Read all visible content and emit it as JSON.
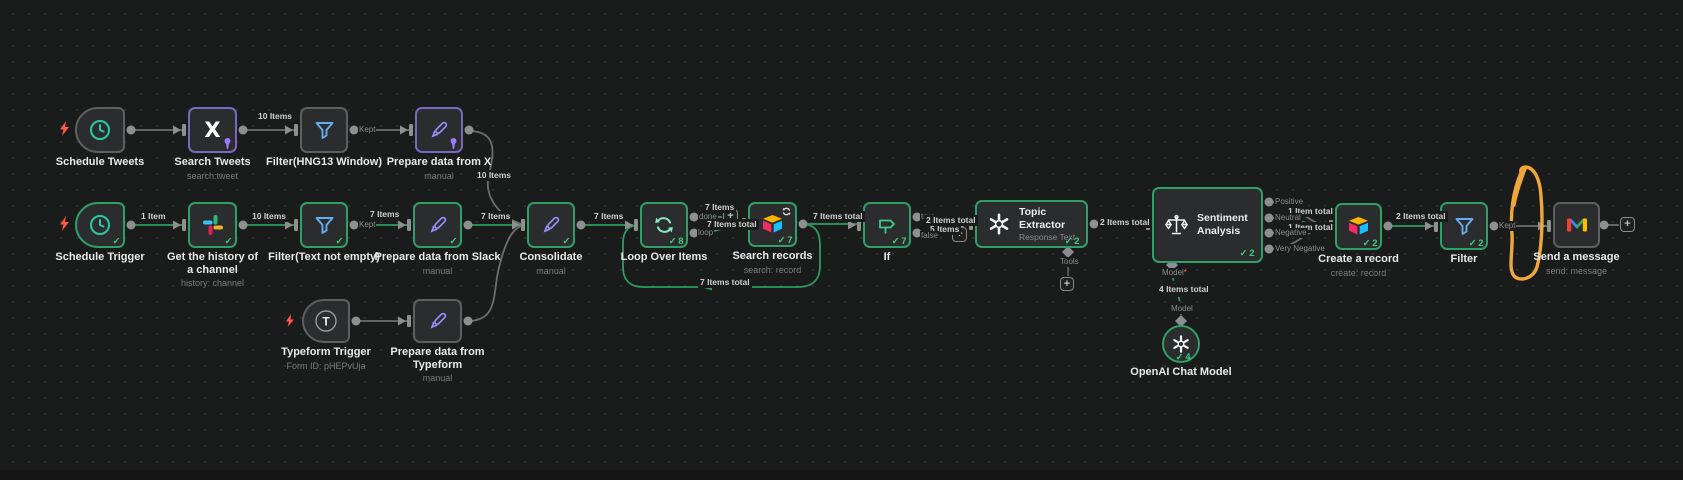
{
  "app": {
    "name": "n8n workflow canvas"
  },
  "colors": {
    "canvas_bg": "#1a1b1b",
    "dot": "#2d2e2e",
    "success_green": "#2f9e68",
    "pinned_purple": "#7a68c0",
    "line_gray": "#6e6e6e",
    "line_green": "#2c9c62",
    "annotation_orange": "#efa63c",
    "bolt_red": "#ff5a47",
    "funnel_blue": "#64aef0",
    "pencil_purple": "#9e8bf5",
    "clock_teal": "#2cc7a4",
    "loop_mint": "#87e5c0",
    "if_green": "#40cb83"
  },
  "nodes": {
    "schedule_tweets": {
      "title": "Schedule Tweets"
    },
    "search_tweets": {
      "title": "Search Tweets",
      "subtitle": "search:tweet"
    },
    "filter_hng13": {
      "title": "Filter(HNG13 Window)"
    },
    "prepare_x": {
      "title": "Prepare data from X",
      "subtitle": "manual"
    },
    "schedule_trigger": {
      "title": "Schedule Trigger",
      "badge": "✓"
    },
    "get_history": {
      "title": "Get the history of a channel",
      "subtitle": "history: channel",
      "badge": "✓"
    },
    "filter_text": {
      "title": "Filter(Text not empty)",
      "badge": "✓"
    },
    "prepare_slack": {
      "title": "Prepare data from Slack",
      "subtitle": "manual",
      "badge": "✓"
    },
    "typeform_trigger": {
      "title": "Typeform Trigger",
      "subtitle": "Form ID: pHEPvUja"
    },
    "prepare_typeform": {
      "title": "Prepare data from Typeform",
      "subtitle": "manual"
    },
    "consolidate": {
      "title": "Consolidate",
      "subtitle": "manual",
      "badge": "✓"
    },
    "loop_over_items": {
      "title": "Loop Over Items",
      "badge": "✓ 8"
    },
    "search_records": {
      "title": "Search records",
      "subtitle": "search: record",
      "badge": "✓ 7"
    },
    "if_node": {
      "title": "If",
      "badge": "✓ 7"
    },
    "topic_extractor": {
      "title": "Topic Extractor",
      "subtitle": "Response Text",
      "badge": "✓ 2"
    },
    "sentiment": {
      "title": "Sentiment Analysis",
      "badge": "✓ 2"
    },
    "create_record": {
      "title": "Create a record",
      "subtitle": "create: record",
      "badge": "✓ 2"
    },
    "filter_send": {
      "title": "Filter",
      "badge": "✓ 2"
    },
    "send_message": {
      "title": "Send a message",
      "subtitle": "send: message"
    },
    "openai_model": {
      "title": "OpenAI Chat Model",
      "badge": "✓ 4"
    }
  },
  "counts": {
    "tweets_filter": "10 Items",
    "x_consolidate": "10 Items",
    "trigger_slack": "1 Item",
    "slack_filter": "10 Items",
    "filter_prepare": "7 Items",
    "prepare_consolidate": "7 Items",
    "consolidate_loop": "7 Items",
    "loop_done": "7 Items",
    "loop_branch": "7 Items total",
    "loopback": "7 Items total",
    "search_if": "7 Items total",
    "if_true": "2 Items total",
    "if_false": "5 Items",
    "topic_sentiment": "2 Items total",
    "neutral_total": "1 Item total",
    "negative_total": "1 Item total",
    "create_filter": "2 Items total",
    "model_link": "4 Items total"
  },
  "ports": {
    "kept": "Kept",
    "done": "done",
    "loop": "loop",
    "true": "true",
    "false": "false",
    "tools": "Tools",
    "model": "Model",
    "required_mark": "*",
    "positive": "Positive",
    "neutral": "Neutral",
    "negative": "Negative",
    "very_negative": "Very Negative"
  },
  "icons": {
    "x_logo": "X",
    "typeform_t": "T"
  },
  "ui": {
    "plus": "+"
  }
}
